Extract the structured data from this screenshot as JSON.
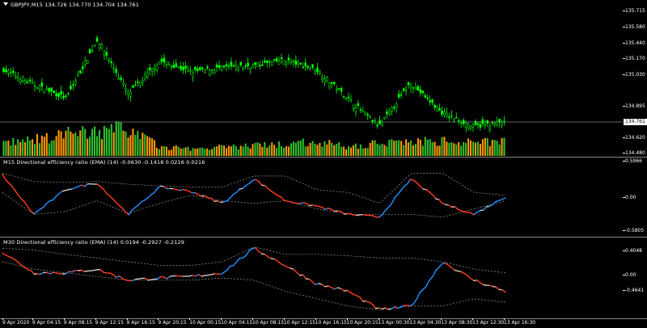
{
  "main": {
    "title": "GBPJPY,M15  134.726 134.770 134.704 134.761",
    "price_ticks": [
      "135.715",
      "135.580",
      "135.440",
      "135.170",
      "135.030",
      "134.895",
      "134.620",
      "134.480"
    ],
    "current_price": "134.761",
    "colors": {
      "candle": "#00ff00",
      "vol_up": "#30c030",
      "vol_down": "#ff9900",
      "price_line": "#c0c0c0"
    }
  },
  "ind1": {
    "title": "M15 Directional efficiency ratio (EMA) (14) -0.0630 -0.1418 0.0216 0.0216",
    "ticks": [
      "0.5966",
      "0.00",
      "-0.5805"
    ]
  },
  "ind2": {
    "title": "M30 Directional efficiency ratio (EMA) (14) 0.0194 -0.2927 -0.2129",
    "ticks": [
      "0.4048",
      "0.00",
      "-0.4641"
    ]
  },
  "indicator_colors": {
    "up": "#1e90ff",
    "down": "#ff3b1f",
    "neutral": "#c8c8c8",
    "envelope": "#9a9a9a"
  },
  "time_axis": [
    "9 Apr 2020",
    "9 Apr 04:15",
    "9 Apr 08:15",
    "9 Apr 12:15",
    "9 Apr 16:15",
    "9 Apr 20:15",
    "10 Apr 00:15",
    "10 Apr 04:15",
    "10 Apr 08:15",
    "10 Apr 12:15",
    "10 Apr 16:15",
    "10 Apr 20:15",
    "13 Apr 00:30",
    "13 Apr 04:30",
    "13 Apr 08:30",
    "13 Apr 12:30",
    "13 Apr 16:30"
  ],
  "chart_data": [
    {
      "type": "candlestick",
      "title": "GBPJPY,M15",
      "ylim": [
        134.48,
        135.85
      ],
      "x": [
        "9 Apr 2020",
        "9 Apr 04:15",
        "9 Apr 08:15",
        "9 Apr 12:15",
        "9 Apr 16:15",
        "9 Apr 20:15",
        "10 Apr 00:15",
        "10 Apr 04:15",
        "10 Apr 08:15",
        "10 Apr 12:15",
        "10 Apr 16:15",
        "10 Apr 20:15",
        "13 Apr 00:30",
        "13 Apr 04:30",
        "13 Apr 08:30",
        "13 Apr 12:30",
        "13 Apr 16:30"
      ],
      "close": [
        135.24,
        135.1,
        134.98,
        135.52,
        135.02,
        135.32,
        135.22,
        135.26,
        135.28,
        135.33,
        135.24,
        134.98,
        134.72,
        135.12,
        134.85,
        134.72,
        134.76
      ],
      "volume": [
        18,
        22,
        30,
        34,
        38,
        12,
        10,
        12,
        14,
        16,
        20,
        12,
        18,
        20,
        20,
        18,
        22
      ]
    },
    {
      "type": "line",
      "title": "M15 Directional efficiency ratio (EMA) (14)",
      "ylim": [
        -0.62,
        0.62
      ],
      "x": [
        "9 Apr 2020",
        "9 Apr 04:15",
        "9 Apr 08:15",
        "9 Apr 12:15",
        "9 Apr 16:15",
        "9 Apr 20:15",
        "10 Apr 00:15",
        "10 Apr 04:15",
        "10 Apr 08:15",
        "10 Apr 12:15",
        "10 Apr 16:15",
        "10 Apr 20:15",
        "13 Apr 00:30",
        "13 Apr 04:30",
        "13 Apr 08:30",
        "13 Apr 12:30",
        "13 Apr 16:30"
      ],
      "values": [
        0.42,
        -0.3,
        0.15,
        0.28,
        -0.3,
        0.2,
        0.12,
        -0.1,
        0.35,
        -0.05,
        -0.15,
        -0.3,
        -0.35,
        0.35,
        -0.1,
        -0.3,
        0.02
      ],
      "upper": [
        0.45,
        0.3,
        0.28,
        0.3,
        0.25,
        0.22,
        0.2,
        0.2,
        0.4,
        0.4,
        0.15,
        0.1,
        -0.1,
        0.45,
        0.45,
        0.1,
        0.05
      ],
      "lower": [
        0.1,
        -0.3,
        -0.25,
        -0.05,
        -0.28,
        -0.1,
        0.05,
        -0.05,
        -0.1,
        -0.05,
        -0.2,
        -0.3,
        -0.3,
        -0.3,
        -0.35,
        -0.2,
        -0.05
      ]
    },
    {
      "type": "line",
      "title": "M30 Directional efficiency ratio (EMA) (14)",
      "ylim": [
        -0.5,
        0.44
      ],
      "x": [
        "9 Apr 2020",
        "9 Apr 04:15",
        "9 Apr 08:15",
        "9 Apr 12:15",
        "9 Apr 16:15",
        "9 Apr 20:15",
        "10 Apr 00:15",
        "10 Apr 04:15",
        "10 Apr 08:15",
        "10 Apr 12:15",
        "10 Apr 16:15",
        "10 Apr 20:15",
        "13 Apr 00:30",
        "13 Apr 04:30",
        "13 Apr 08:30",
        "13 Apr 12:30",
        "13 Apr 16:30"
      ],
      "values": [
        0.33,
        0.05,
        0.05,
        0.1,
        -0.05,
        -0.02,
        0.0,
        0.05,
        0.38,
        0.15,
        -0.1,
        -0.2,
        -0.45,
        -0.4,
        0.2,
        -0.05,
        -0.2
      ],
      "upper": [
        0.38,
        0.36,
        0.3,
        0.25,
        0.2,
        0.15,
        0.15,
        0.2,
        0.4,
        0.3,
        0.3,
        0.28,
        0.25,
        0.25,
        0.2,
        0.1,
        0.05
      ],
      "lower": [
        0.2,
        0.1,
        0.05,
        0.0,
        -0.05,
        -0.05,
        -0.05,
        -0.02,
        -0.05,
        -0.2,
        -0.3,
        -0.4,
        -0.45,
        -0.4,
        -0.4,
        -0.3,
        -0.35
      ]
    }
  ]
}
